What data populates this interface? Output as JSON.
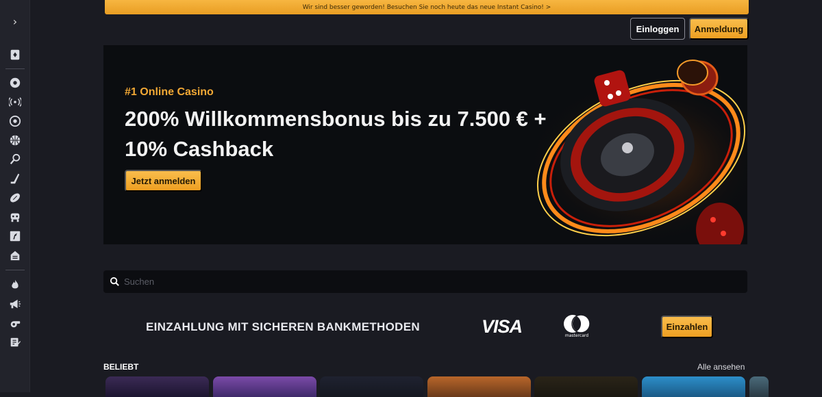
{
  "promo_banner": {
    "text": "Wir sind besser geworden! Besuchen Sie noch heute das neue Instant Casino! >"
  },
  "header": {
    "login_label": "Einloggen",
    "register_label": "Anmeldung"
  },
  "sidebar": {
    "toggle_icon": "chevron-right-icon",
    "items": [
      {
        "icon": "casino-card-icon"
      },
      {
        "icon": "sports-icon"
      },
      {
        "icon": "live-broadcast-icon"
      },
      {
        "icon": "soccer-icon"
      },
      {
        "icon": "basketball-icon"
      },
      {
        "icon": "tennis-icon"
      },
      {
        "icon": "hockey-icon"
      },
      {
        "icon": "american-football-icon"
      },
      {
        "icon": "esports-icon"
      },
      {
        "icon": "horse-racing-icon"
      },
      {
        "icon": "virtual-sports-icon"
      },
      {
        "icon": "hot-fire-icon"
      },
      {
        "icon": "promotions-megaphone-icon"
      },
      {
        "icon": "whistle-icon"
      },
      {
        "icon": "betslip-edit-icon"
      }
    ]
  },
  "hero": {
    "kicker": "#1 Online Casino",
    "title": "200% Willkommensbonus bis zu 7.500 € + 10% Cashback",
    "cta_label": "Jetzt anmelden"
  },
  "search": {
    "placeholder": "Suchen"
  },
  "bank": {
    "title": "EINZAHLUNG MIT SICHEREN BANKMETHODEN",
    "visa_label": "VISA",
    "mastercard_label": "mastercard",
    "deposit_label": "Einzahlen"
  },
  "popular": {
    "title": "BELIEBT",
    "see_all_label": "Alle ansehen"
  },
  "colors": {
    "accent": "#f2a52c",
    "background": "#1a1b22",
    "sidebar": "#22232b"
  }
}
